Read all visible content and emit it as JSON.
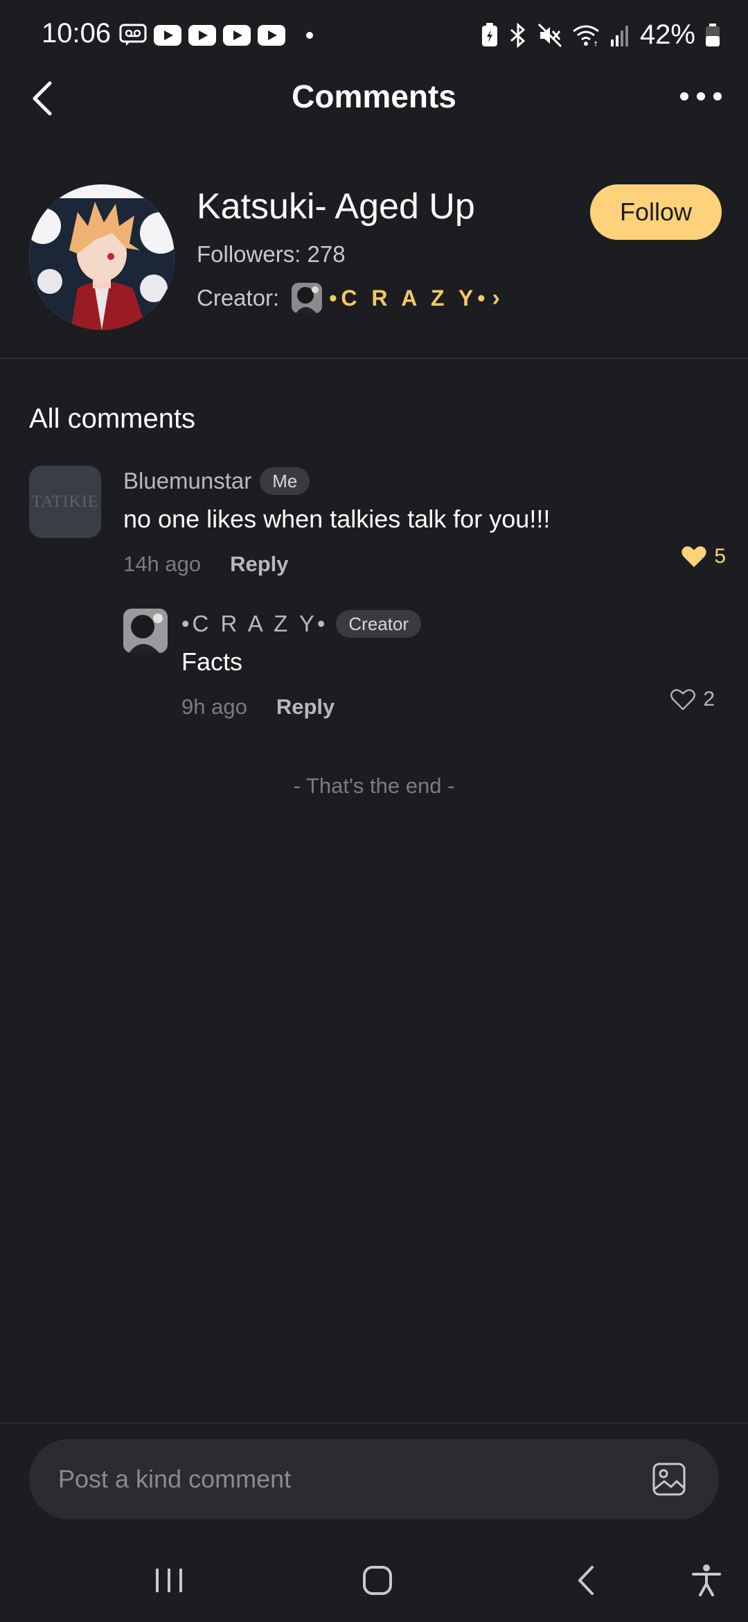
{
  "status_bar": {
    "time": "10:06",
    "battery": "42%"
  },
  "header": {
    "title": "Comments"
  },
  "profile": {
    "name": "Katsuki- Aged Up",
    "followers": "Followers: 278",
    "creator_label": "Creator",
    "creator_colon": ":",
    "creator_name": "•C R A Z Y•",
    "follow_label": "Follow"
  },
  "section_title": "All comments",
  "comments": [
    {
      "user": "Bluemunstar",
      "tag": "Me",
      "avatar_text": "TATIKIE",
      "text": "no one likes when talkies talk for you!!!",
      "time": "14h ago",
      "reply_label": "Reply",
      "likes": "5",
      "liked": true
    }
  ],
  "replies": [
    {
      "user": "•C R A Z Y•",
      "tag": "Creator",
      "text": "Facts",
      "time": "9h ago",
      "reply_label": "Reply",
      "likes": "2",
      "liked": false
    }
  ],
  "end_text": "- That's the end -",
  "input": {
    "placeholder": "Post a kind comment"
  },
  "colors": {
    "background": "#1c1d21",
    "accent": "#fdd27a",
    "creator_name": "#f6c864"
  },
  "icons": {
    "back": "chevron-left-icon",
    "more": "more-dots-icon",
    "like_filled": "heart-filled-icon",
    "like_outline": "heart-outline-icon",
    "image": "image-icon",
    "nav_recent": "recent-apps-icon",
    "nav_home": "home-icon",
    "nav_back": "nav-back-icon",
    "accessibility": "accessibility-icon"
  }
}
